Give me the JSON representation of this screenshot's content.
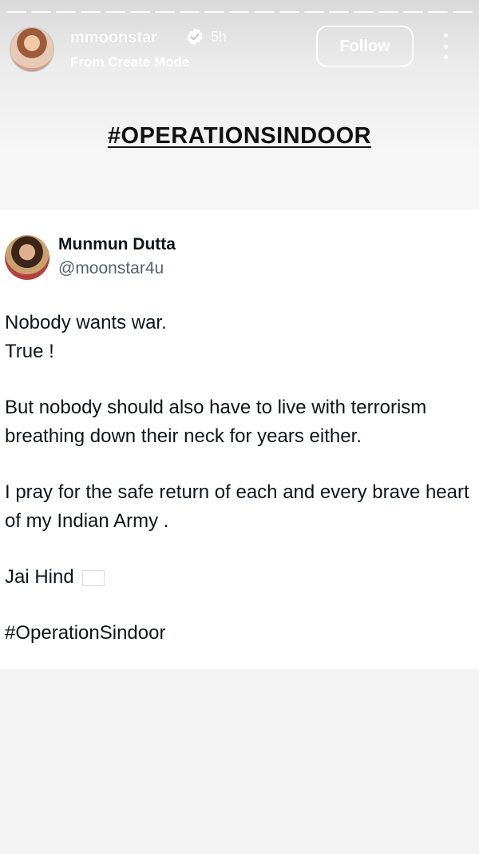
{
  "story": {
    "progress_segments": 19,
    "username": "mmoonstar",
    "verified_icon": "verified-badge-icon",
    "time": "5h",
    "subline": "From Create Mode",
    "follow_label": "Follow",
    "more_icon": "more-vertical-icon",
    "headline": "#OPERATIONSINDOOR"
  },
  "tweet": {
    "name": "Munmun Dutta",
    "handle": "@moonstar4u",
    "line1": "Nobody wants war.",
    "line2": "True !",
    "para2": "But nobody should also have to live with terrorism breathing down their neck for years either.",
    "para3": "I pray for the safe return of each and every brave heart of my Indian Army .",
    "jai_hind": "Jai Hind",
    "flag_icon": "indian-flag-icon",
    "hashtag": "#OperationSindoor",
    "hashtag_color": "#1d9bf0"
  }
}
